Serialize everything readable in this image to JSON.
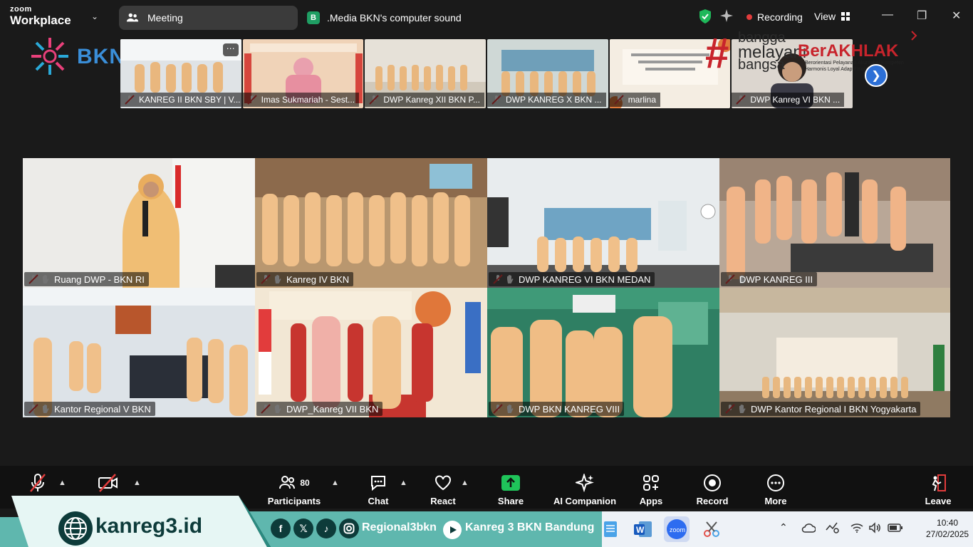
{
  "app": {
    "brand_top": "zoom",
    "brand_bottom": "Workplace"
  },
  "titlebar": {
    "meeting_label": "Meeting",
    "sound_badge": "B",
    "sound_text": ".Media BKN's computer sound",
    "recording_label": "Recording",
    "view_label": "View"
  },
  "thumbnails": [
    {
      "label": "KANREG II BKN SBY | V...",
      "color": "#dfe3e6"
    },
    {
      "label": "Imas Sukmariah - Sest...",
      "color": "#f0d3b8"
    },
    {
      "label": "DWP Kanreg XII BKN P...",
      "color": "#d6d0c4"
    },
    {
      "label": "DWP KANREG X BKN ...",
      "color": "#97b9c8"
    },
    {
      "label": "marlina",
      "color": "#efe6d6"
    },
    {
      "label": "DWP Kanreg VI BKN ...",
      "color": "#dcd6cf"
    }
  ],
  "logo": {
    "bkn": "BKN"
  },
  "berakhlak": {
    "line1": "bangga",
    "line2": "melayani",
    "line3": "bangsa",
    "big": "BerAKHLAK",
    "sub": "Berorientasi Pelayanan Akuntabel Kompeten Harmonis Loyal Adaptif Kolaboratif"
  },
  "tiles": [
    {
      "label": "Ruang DWP - BKN RI",
      "color": "#e8e4de"
    },
    {
      "label": "Kanreg IV BKN",
      "color": "#c9a57c"
    },
    {
      "label": "DWP KANREG VI BKN MEDAN",
      "color": "#9fb7c4"
    },
    {
      "label": "DWP KANREG III",
      "color": "#c8b7a8"
    },
    {
      "label": "Kantor Regional V BKN",
      "color": "#b8c4cc"
    },
    {
      "label": "DWP_Kanreg VII BKN",
      "color": "#d9b48e"
    },
    {
      "label": "DWP BKN KANREG VIII",
      "color": "#a7c7b3"
    },
    {
      "label": "DWP Kantor Regional I BKN Yogyakarta",
      "color": "#d6cbb8"
    }
  ],
  "toolbar": {
    "participants_count": "80",
    "participants": "Participants",
    "chat": "Chat",
    "react": "React",
    "share": "Share",
    "ai_companion": "AI Companion",
    "apps": "Apps",
    "record": "Record",
    "more": "More",
    "leave": "Leave"
  },
  "banner": {
    "site": "kanreg3.id",
    "social_handle": "Regional3bkn",
    "youtube": "Kanreg 3 BKN Bandung"
  },
  "taskbar": {
    "time": "10:40",
    "date": "27/02/2025"
  },
  "colors": {
    "accent_red": "#e23c3c",
    "zoom_green": "#1f9e63",
    "share_green": "#1fc45a",
    "teal": "#5fb7ae",
    "dark_teal": "#0d3b3a"
  }
}
